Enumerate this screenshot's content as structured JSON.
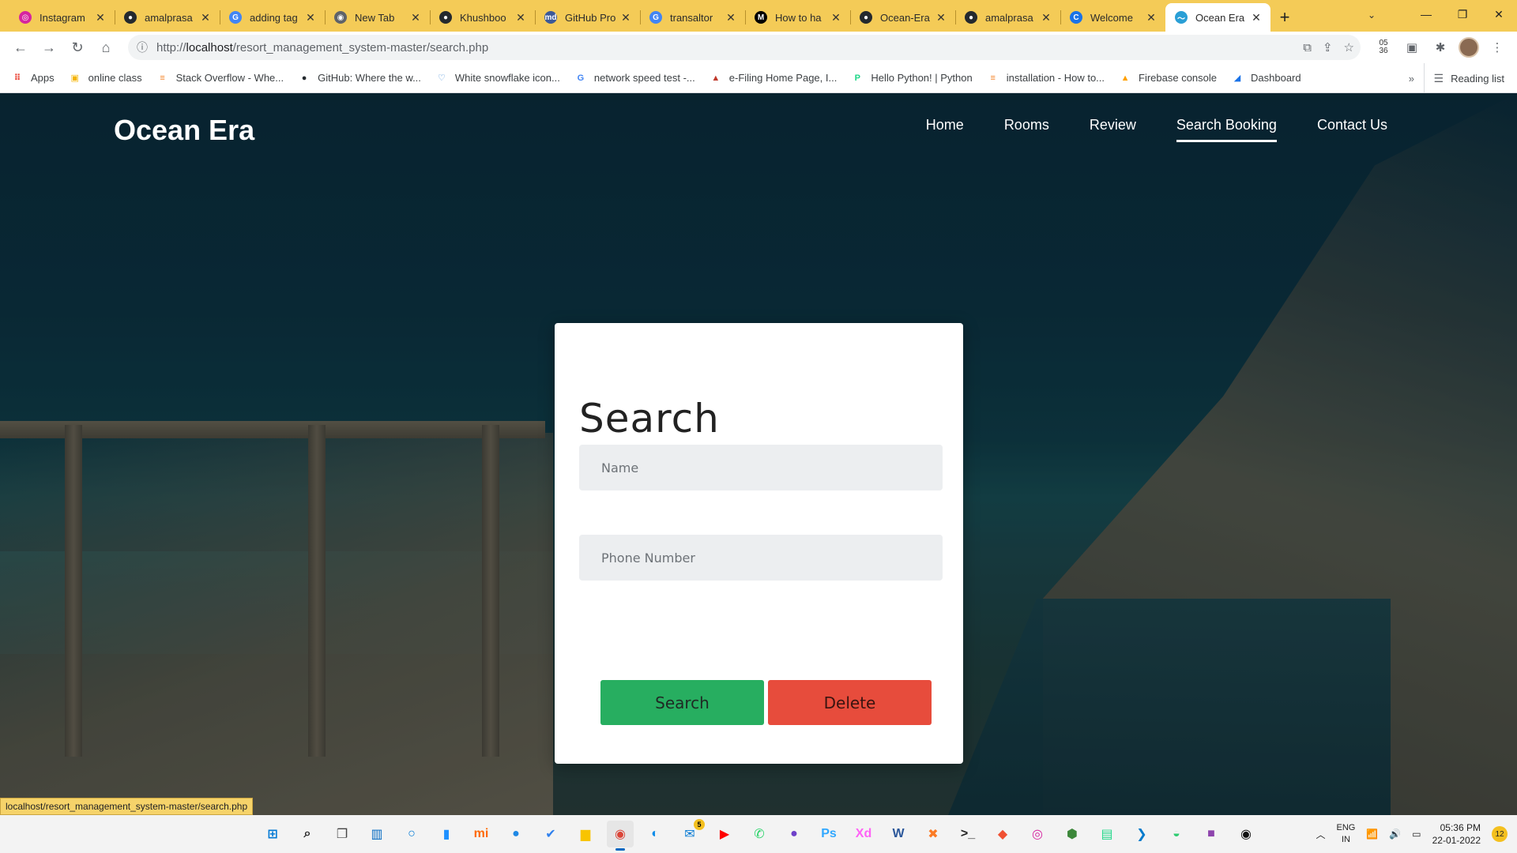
{
  "browser": {
    "tabs": [
      {
        "title": "Instagram",
        "icon": "instagram-icon",
        "color": "#d6249f",
        "glyph": "◎"
      },
      {
        "title": "amalprasa",
        "icon": "github-icon",
        "color": "#24292e",
        "glyph": "●"
      },
      {
        "title": "adding tag",
        "icon": "google-icon",
        "color": "#4285f4",
        "glyph": "G"
      },
      {
        "title": "New Tab",
        "icon": "chrome-icon",
        "color": "#5f6368",
        "glyph": "◉"
      },
      {
        "title": "Khushboo",
        "icon": "github-icon",
        "color": "#24292e",
        "glyph": "●"
      },
      {
        "title": "GitHub Pro",
        "icon": "readme-icon",
        "color": "#3b5998",
        "glyph": "md"
      },
      {
        "title": "transaltor",
        "icon": "google-icon",
        "color": "#4285f4",
        "glyph": "G"
      },
      {
        "title": "How to ha",
        "icon": "medium-icon",
        "color": "#000000",
        "glyph": "M"
      },
      {
        "title": "Ocean-Era",
        "icon": "github-icon",
        "color": "#24292e",
        "glyph": "●"
      },
      {
        "title": "amalprasa",
        "icon": "github-icon",
        "color": "#24292e",
        "glyph": "●"
      },
      {
        "title": "Welcome",
        "icon": "c-icon",
        "color": "#1a73e8",
        "glyph": "C"
      },
      {
        "title": "Ocean Era",
        "icon": "wave-icon",
        "color": "#2a9fd6",
        "glyph": "〜",
        "active": true
      }
    ],
    "url_prefix": "http://",
    "url_host": "localhost",
    "url_path": "/resort_management_system-master/search.php",
    "ext_time": "05\n36",
    "bookmarks": [
      {
        "label": "Apps",
        "icon": "apps-grid-icon",
        "color": "#ea4335",
        "glyph": "⠿"
      },
      {
        "label": "online class",
        "icon": "classroom-icon",
        "color": "#f4b400",
        "glyph": "▣"
      },
      {
        "label": "Stack Overflow - Whe...",
        "icon": "stackoverflow-icon",
        "color": "#f48024",
        "glyph": "≡"
      },
      {
        "label": "GitHub: Where the w...",
        "icon": "github-icon",
        "color": "#24292e",
        "glyph": "●"
      },
      {
        "label": "White snowflake icon...",
        "icon": "heart-icon",
        "color": "#4a90d9",
        "glyph": "♡"
      },
      {
        "label": "network speed test -...",
        "icon": "google-icon",
        "color": "#4285f4",
        "glyph": "G"
      },
      {
        "label": "e-Filing Home Page, I...",
        "icon": "efiling-icon",
        "color": "#c0392b",
        "glyph": "▲"
      },
      {
        "label": "Hello Python! | Python",
        "icon": "pycharm-icon",
        "color": "#21d789",
        "glyph": "P"
      },
      {
        "label": "installation - How to...",
        "icon": "stackexchange-icon",
        "color": "#f48024",
        "glyph": "≡"
      },
      {
        "label": "Firebase console",
        "icon": "firebase-icon",
        "color": "#ffa000",
        "glyph": "▲"
      },
      {
        "label": "Dashboard",
        "icon": "dashboard-icon",
        "color": "#1a73e8",
        "glyph": "◢"
      }
    ],
    "more": "»",
    "reading_list": "Reading list",
    "status_url": "localhost/resort_management_system-master/search.php"
  },
  "site": {
    "brand": "Ocean Era",
    "nav": [
      {
        "label": "Home",
        "active": false
      },
      {
        "label": "Rooms",
        "active": false
      },
      {
        "label": "Review",
        "active": false
      },
      {
        "label": "Search Booking",
        "active": true
      },
      {
        "label": "Contact Us",
        "active": false
      }
    ],
    "form": {
      "title": "Search",
      "name_placeholder": "Name",
      "name_value": "",
      "phone_placeholder": "Phone Number",
      "phone_value": "",
      "search_label": "Search",
      "delete_label": "Delete"
    }
  },
  "taskbar": {
    "apps": [
      {
        "name": "windows-start-icon",
        "color": "#0078d4",
        "glyph": "⊞"
      },
      {
        "name": "search-icon",
        "color": "#222222",
        "glyph": "⌕"
      },
      {
        "name": "task-view-icon",
        "color": "#444444",
        "glyph": "❐"
      },
      {
        "name": "widgets-icon",
        "color": "#0067c0",
        "glyph": "▥"
      },
      {
        "name": "cortana-icon",
        "color": "#0078d4",
        "glyph": "○"
      },
      {
        "name": "phone-link-icon",
        "color": "#1e90ff",
        "glyph": "▮"
      },
      {
        "name": "mi-icon",
        "color": "#ff6900",
        "glyph": "mi"
      },
      {
        "name": "edge-drop-icon",
        "color": "#1e88e5",
        "glyph": "●"
      },
      {
        "name": "todo-icon",
        "color": "#2f80ed",
        "glyph": "✔"
      },
      {
        "name": "file-explorer-icon",
        "color": "#f8c400",
        "glyph": "▆"
      },
      {
        "name": "chrome-icon",
        "color": "#db4437",
        "glyph": "◉",
        "active": true
      },
      {
        "name": "edge-icon",
        "color": "#0c8ce9",
        "glyph": "◐"
      },
      {
        "name": "mail-icon",
        "color": "#0078d4",
        "glyph": "✉",
        "badge": "5"
      },
      {
        "name": "youtube-icon",
        "color": "#ff0000",
        "glyph": "▶"
      },
      {
        "name": "whatsapp-icon",
        "color": "#25d366",
        "glyph": "✆"
      },
      {
        "name": "github-desktop-icon",
        "color": "#6e40c9",
        "glyph": "●"
      },
      {
        "name": "photoshop-icon",
        "color": "#31a8ff",
        "glyph": "Ps"
      },
      {
        "name": "xd-icon",
        "color": "#ff61f6",
        "glyph": "Xd"
      },
      {
        "name": "word-icon",
        "color": "#2b579a",
        "glyph": "W"
      },
      {
        "name": "xampp-icon",
        "color": "#fb7a24",
        "glyph": "✖"
      },
      {
        "name": "terminal-icon",
        "color": "#222222",
        "glyph": ">_"
      },
      {
        "name": "git-icon",
        "color": "#f05032",
        "glyph": "◆"
      },
      {
        "name": "instagram-app-icon",
        "color": "#d6249f",
        "glyph": "◎"
      },
      {
        "name": "node-icon",
        "color": "#3c873a",
        "glyph": "⬢"
      },
      {
        "name": "pycharm-app-icon",
        "color": "#21d789",
        "glyph": "▤"
      },
      {
        "name": "vscode-icon",
        "color": "#007acc",
        "glyph": "❯"
      },
      {
        "name": "gamepad-icon",
        "color": "#2ecc71",
        "glyph": "◒"
      },
      {
        "name": "color-app-icon",
        "color": "#8e44ad",
        "glyph": "■"
      },
      {
        "name": "record-icon",
        "color": "#111111",
        "glyph": "◉"
      }
    ],
    "lang_top": "ENG",
    "lang_bottom": "IN",
    "time": "05:36 PM",
    "date": "22-01-2022",
    "notifications": "12"
  }
}
